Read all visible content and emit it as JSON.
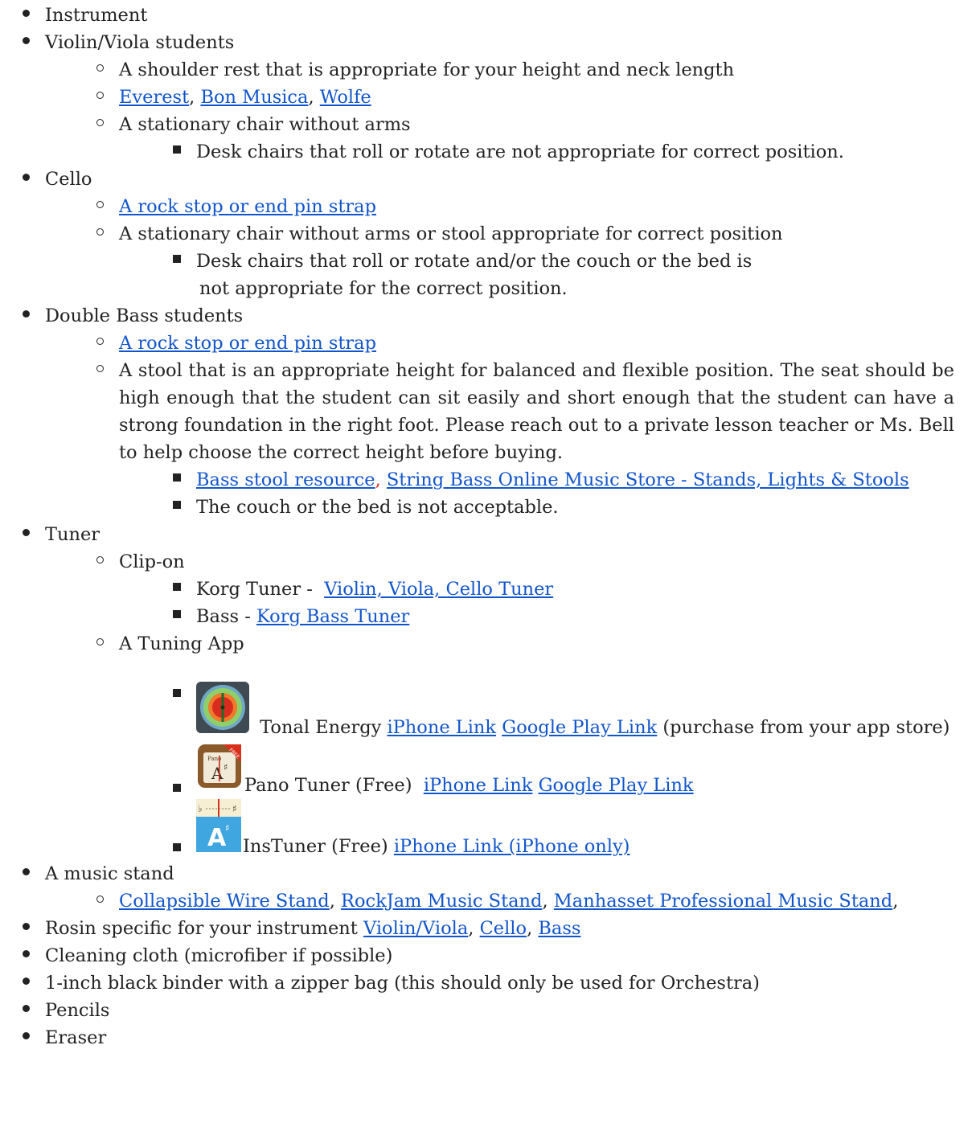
{
  "items": {
    "instrument": "Instrument",
    "violin_viola": "Violin/Viola students",
    "shoulder_rest": "A shoulder rest that is appropriate for your height and neck length",
    "everest": "Everest",
    "bon_musica": "Bon Musica",
    "wolfe": "Wolfe",
    "sep_comma": ", ",
    "stationary_chair": "A stationary chair without arms",
    "desk_chairs_vv": "Desk chairs that roll or rotate are not appropriate for correct position.",
    "cello": "Cello",
    "rock_stop_cello": "A rock stop or end pin strap",
    "cello_chair": "A stationary chair without arms or stool appropriate for correct position",
    "cello_desk_line1": "Desk chairs that roll or rotate and/or the  couch or the bed is",
    "cello_desk_line2": "not appropriate for the correct position.",
    "double_bass": "Double Bass students",
    "rock_stop_bass": "A rock stop or end pin strap",
    "bass_stool_text": "A stool that is an appropriate height for balanced and flexible position. The seat should be high enough that the student can sit easily and short enough that the student can have a strong foundation in the right foot. Please reach out to a private lesson teacher or Ms. Bell to help choose the correct height before buying.",
    "bass_stool_resource": "Bass stool resource",
    "sbo_store": "String Bass Online Music Store - Stands, Lights & Stools",
    "couch_bed": "The couch or the bed is not acceptable.",
    "tuner": "Tuner",
    "clip_on": "Clip-on",
    "korg_prefix": "Korg Tuner -  ",
    "korg_vvc": "Violin, Viola, Cello Tuner",
    "bass_prefix": "Bass - ",
    "korg_bass": "Korg Bass Tuner",
    "tuning_app": "A Tuning App",
    "tonal_energy": " Tonal Energy ",
    "te_iphone": "iPhone Link",
    "te_google": "Google Play Link",
    "te_suffix": " (purchase from your app store)",
    "pano_name": "Pano Tuner (Free)  ",
    "pano_iphone": "iPhone Link",
    "pano_google": "Google Play Link",
    "ins_name": "InsTuner (Free) ",
    "ins_iphone": "iPhone Link (iPhone only)",
    "music_stand": "A music stand",
    "wire_stand": "Collapsible Wire Stand",
    "rockjam": "RockJam Music Stand",
    "manhasset": "Manhasset Professional Music Stand",
    "trailing_comma": ",",
    "rosin_prefix": "Rosin specific for your instrument ",
    "rosin_vv": "Violin/Viola",
    "rosin_cello": "Cello",
    "rosin_bass": "Bass",
    "cloth": "Cleaning cloth (microfiber if possible)",
    "binder": "1-inch black binder with a zipper bag (this should only be used for Orchestra)",
    "pencils": "Pencils",
    "eraser": "Eraser"
  },
  "icons": {
    "tonal_energy": "tonal-energy-app-icon",
    "pano_tuner": "pano-tuner-app-icon",
    "instuner": "instuner-app-icon",
    "pano_badge": "FREE"
  },
  "colors": {
    "link": "#1155cc",
    "text": "#222222",
    "separator_red": "#e0301e"
  }
}
